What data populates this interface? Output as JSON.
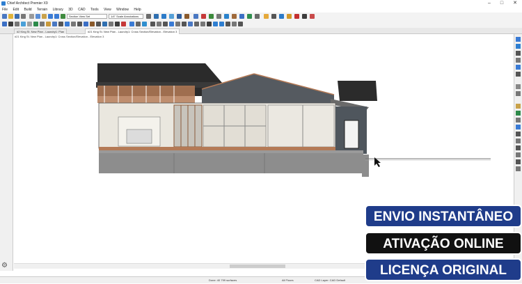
{
  "window": {
    "title": "Chief Architect Premier X9",
    "controls": [
      "–",
      "□",
      "✕"
    ]
  },
  "menubar": {
    "items": [
      "File",
      "Edit",
      "Build",
      "Terrain",
      "Library",
      "3D",
      "CAD",
      "Tools",
      "View",
      "Window",
      "Help"
    ]
  },
  "toolbar": {
    "layer_set": "Section View Set",
    "annotation_set": "1/4\" Scale Annotations"
  },
  "tabs": [
    {
      "label": "#2 King St. New Plan - Laundry1: Plan"
    },
    {
      "label": "#21 King St. New Plan - Laundry1: Cross Section/Elevation - Elevation 3"
    }
  ],
  "view": {
    "label": "#21 King St. New Plan - Laundry1: Cross Section/Elevation - Elevation 3"
  },
  "status": {
    "left": "Done: 40 799 surfaces",
    "mid": "All Floors",
    "right": "CAD Layer: CAD Default"
  },
  "badges": {
    "b1": "ENVIO INSTANTÂNEO",
    "b2": "ATIVAÇÃO ONLINE",
    "b3": "LICENÇA ORIGINAL"
  },
  "colors": {
    "brand_blue": "#1f3c8a",
    "roof": "#2b2b2b",
    "wall": "#eae7df",
    "foundation": "#8d8d8d",
    "framing": "#b47a56"
  }
}
